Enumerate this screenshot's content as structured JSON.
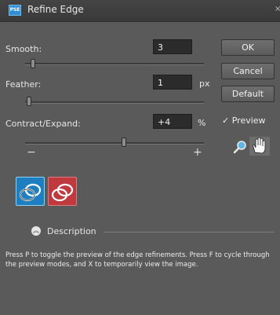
{
  "window": {
    "title": "Refine Edge",
    "app_icon": "PSE",
    "close": "×"
  },
  "smooth": {
    "label": "Smooth:",
    "value": "3",
    "slider": 0.03
  },
  "feather": {
    "label": "Feather:",
    "value": "1",
    "unit": "px",
    "slider": 0.01
  },
  "contract": {
    "label": "Contract/Expand:",
    "value": "+4",
    "unit": "%",
    "slider": 0.54,
    "minus": "−",
    "plus": "+"
  },
  "buttons": {
    "ok": "OK",
    "cancel": "Cancel",
    "default": "Default"
  },
  "preview": {
    "label": "Preview",
    "checked": true
  },
  "tools": [
    "zoom-icon",
    "hand-icon"
  ],
  "modes": [
    "preview-mode-normal-icon",
    "preview-mode-overlay-icon"
  ],
  "description": {
    "title": "Description",
    "text": "Press P to toggle the preview of the edge refinements. Press F to cycle through the preview modes, and X to temporarily view the image."
  },
  "colors": {
    "background": "#5a5a5a",
    "mode_selected": "#1e7fc0",
    "mode_red": "#c0393f"
  }
}
